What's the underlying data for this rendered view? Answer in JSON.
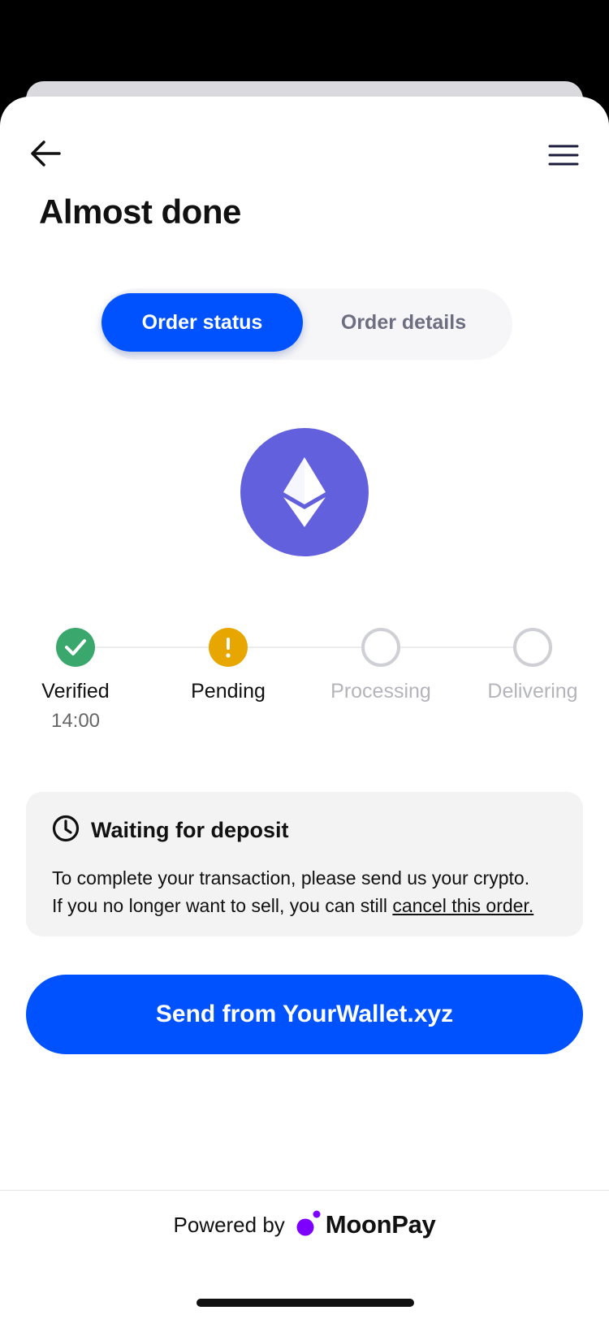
{
  "header": {
    "title": "Almost done",
    "back_icon": "arrow-left-icon",
    "menu_icon": "hamburger-menu-icon"
  },
  "tabs": [
    {
      "label": "Order status",
      "active": true
    },
    {
      "label": "Order details",
      "active": false
    }
  ],
  "asset": {
    "icon": "ethereum-icon",
    "color": "#6360dd"
  },
  "steps": [
    {
      "label": "Verified",
      "time": "14:00",
      "state": "done"
    },
    {
      "label": "Pending",
      "state": "pending"
    },
    {
      "label": "Processing",
      "state": "upcoming"
    },
    {
      "label": "Delivering",
      "state": "upcoming"
    }
  ],
  "info": {
    "icon": "clock-icon",
    "title": "Waiting for deposit",
    "line1": "To complete your transaction, please send us your crypto.",
    "line2_prefix": "If you no longer want to sell, you can still ",
    "cancel_link": "cancel this order."
  },
  "primary_button": {
    "label": "Send from YourWallet.xyz"
  },
  "footer": {
    "powered_by": "Powered by",
    "brand": "MoonPay",
    "brand_icon": "moonpay-logo-icon"
  },
  "colors": {
    "accent": "#0052ff",
    "success": "#3aa76d",
    "warning": "#e8a600",
    "brand_purple": "#7d00ff"
  }
}
